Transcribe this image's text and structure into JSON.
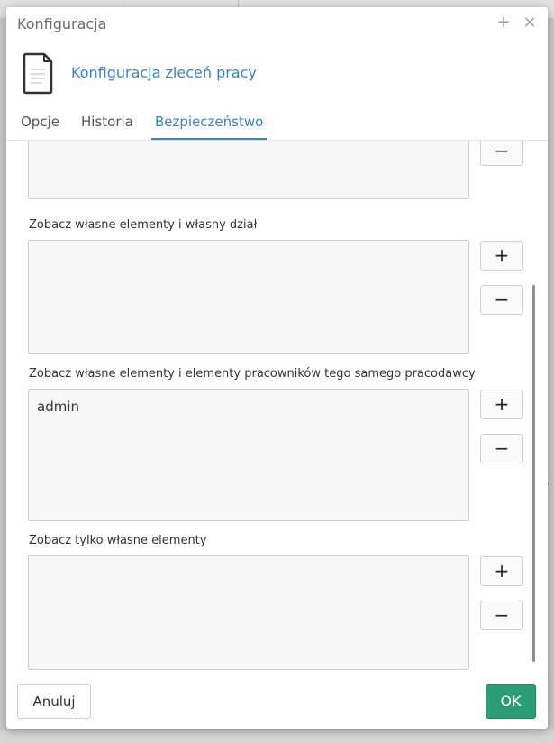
{
  "dialog": {
    "title": "Konfiguracja",
    "header_title": "Konfiguracja zleceń pracy",
    "tabs": [
      {
        "label": "Opcje"
      },
      {
        "label": "Historia"
      },
      {
        "label": "Bezpieczeństwo"
      }
    ],
    "active_tab": "Bezpieczeństwo"
  },
  "sections": [
    {
      "label": "",
      "items": []
    },
    {
      "label": "Zobacz własne elementy i własny dział",
      "items": []
    },
    {
      "label": "Zobacz własne elementy i elementy pracowników tego samego pracodawcy",
      "items": [
        "admin"
      ]
    },
    {
      "label": "Zobacz tylko własne elementy",
      "items": []
    }
  ],
  "buttons": {
    "add": "+",
    "remove": "−",
    "cancel": "Anuluj",
    "ok": "OK",
    "title_plus": "+",
    "title_close": "×"
  }
}
